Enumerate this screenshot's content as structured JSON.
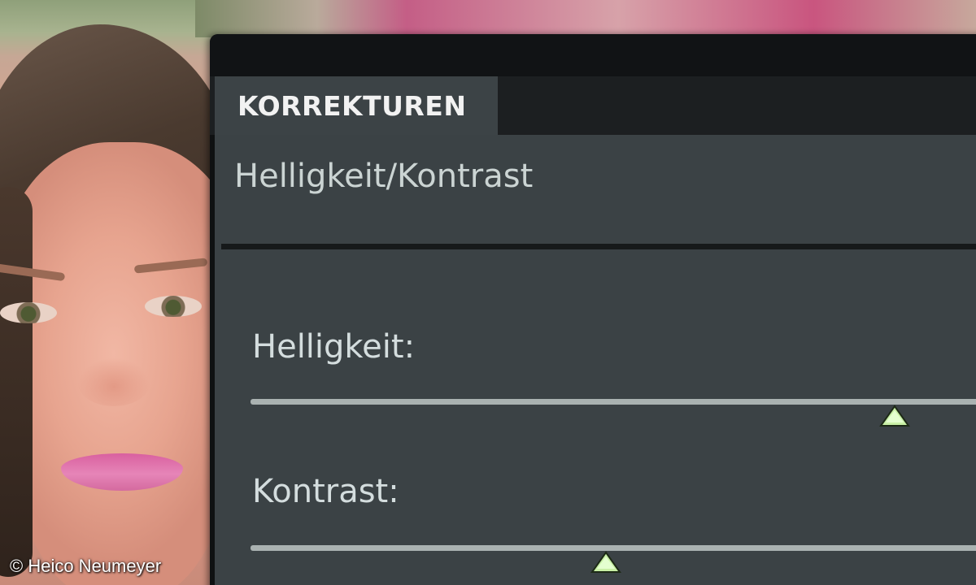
{
  "panel": {
    "tab_label": "KORREKTUREN",
    "adjustment_title": "Helligkeit/Kontrast"
  },
  "sliders": [
    {
      "label": "Helligkeit:",
      "value_fraction": 0.87
    },
    {
      "label": "Kontrast:",
      "value_fraction": 0.48
    }
  ],
  "photo": {
    "copyright": "© Heico Neumeyer"
  },
  "colors": {
    "panel_body": "#3b4245",
    "tab_active": "#3c4346",
    "slider_track": "#aab2b1",
    "thumb_fill": "#c9f0a6"
  },
  "icons": {
    "slider_thumb": "triangle-thumb-icon"
  }
}
